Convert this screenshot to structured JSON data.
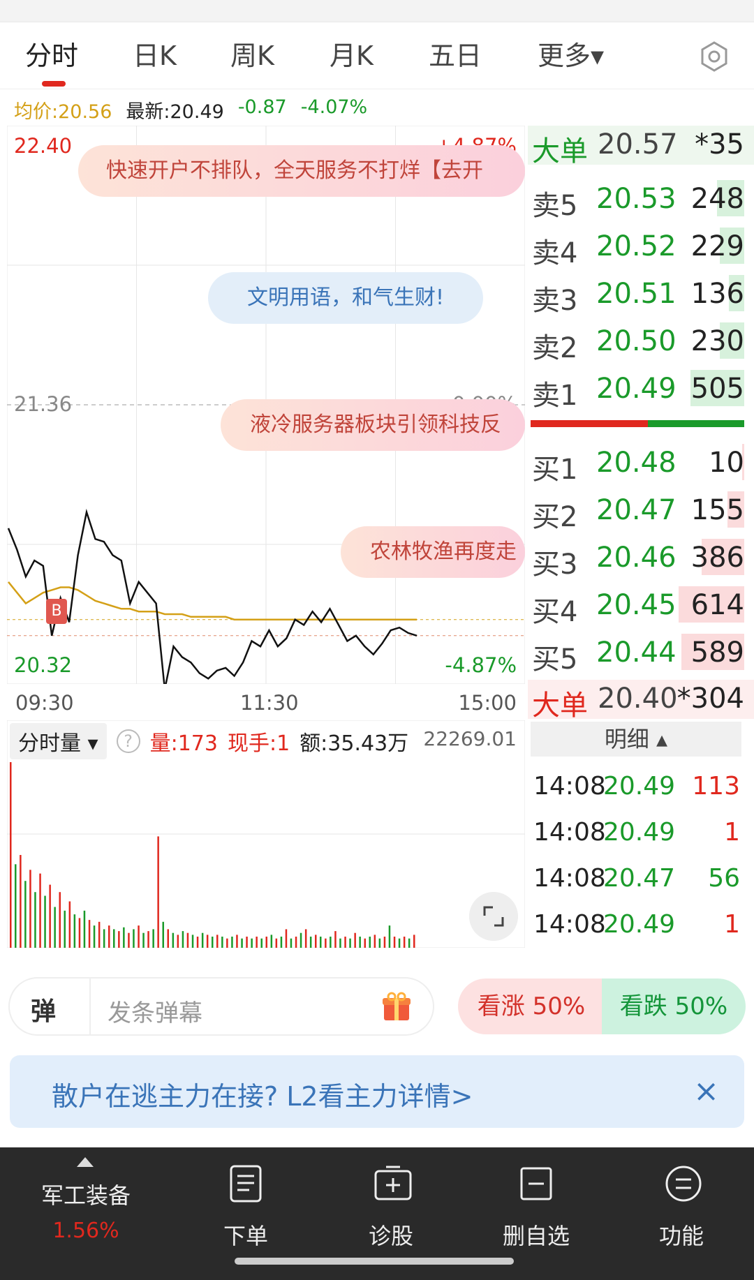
{
  "tabs": [
    {
      "label": "分时",
      "active": true
    },
    {
      "label": "日K"
    },
    {
      "label": "周K"
    },
    {
      "label": "月K"
    },
    {
      "label": "五日"
    },
    {
      "label": "更多▾"
    }
  ],
  "info": {
    "avg": "均价:20.56",
    "latest": "最新:20.49",
    "change": "-0.87",
    "pct": "-4.07%"
  },
  "chart": {
    "y_top": "22.40",
    "y_mid": "21.36",
    "y_bottom": "20.32",
    "pct_top": "+4.87%",
    "pct_mid": "0.00%",
    "pct_bottom": "-4.87%",
    "x_labels": [
      "09:30",
      "11:30",
      "15:00"
    ],
    "marker": "B"
  },
  "chart_data": {
    "type": "line",
    "ylim": [
      20.32,
      22.4
    ],
    "reference": 21.36,
    "series": [
      {
        "values": [
          20.9,
          20.82,
          20.72,
          20.78,
          20.76,
          20.5,
          20.64,
          20.55,
          20.8,
          20.96,
          20.86,
          20.85,
          20.8,
          20.78,
          20.62,
          20.7,
          20.66,
          20.62,
          20.3,
          20.46,
          20.42,
          20.4,
          20.36,
          20.34,
          20.37,
          20.38,
          20.35,
          20.4,
          20.48,
          20.46,
          20.52,
          20.46,
          20.49,
          20.56,
          20.54,
          20.59,
          20.55,
          20.6,
          20.54,
          20.48,
          20.5,
          20.46,
          20.43,
          20.47,
          20.52,
          20.53,
          20.51,
          20.5
        ]
      },
      {
        "values": [
          20.7,
          20.66,
          20.62,
          20.64,
          20.66,
          20.67,
          20.68,
          20.68,
          20.67,
          20.65,
          20.63,
          20.62,
          20.61,
          20.6,
          20.6,
          20.59,
          20.59,
          20.59,
          20.58,
          20.58,
          20.58,
          20.57,
          20.57,
          20.57,
          20.57,
          20.57,
          20.56,
          20.56,
          20.56,
          20.56,
          20.56,
          20.56,
          20.56,
          20.56,
          20.56,
          20.56,
          20.56,
          20.56,
          20.56,
          20.56,
          20.56,
          20.56,
          20.56,
          20.56,
          20.56,
          20.56,
          20.56,
          20.56
        ]
      }
    ]
  },
  "banners": {
    "b1": "快速开户不排队，全天服务不打烊【去开",
    "b2": "文明用语，和气生财!",
    "b3": "液冷服务器板块引领科技反",
    "b4": "农林牧渔再度走"
  },
  "volume": {
    "selector": "分时量",
    "selector_arrow": "▾",
    "help": "?",
    "vol": "量:173",
    "hand": "现手:1",
    "amount": "额:35.43万",
    "max": "22269.01"
  },
  "volume_data": {
    "values": [
      1.0,
      0.45,
      0.5,
      0.36,
      0.42,
      0.3,
      0.4,
      0.28,
      0.34,
      0.22,
      0.3,
      0.2,
      0.25,
      0.18,
      0.16,
      0.2,
      0.15,
      0.12,
      0.14,
      0.1,
      0.12,
      0.1,
      0.09,
      0.11,
      0.08,
      0.1,
      0.12,
      0.08,
      0.09,
      0.1,
      0.6,
      0.14,
      0.1,
      0.08,
      0.07,
      0.09,
      0.08,
      0.07,
      0.06,
      0.08,
      0.07,
      0.06,
      0.07,
      0.06,
      0.05,
      0.06,
      0.07,
      0.05,
      0.06,
      0.05,
      0.06,
      0.05,
      0.06,
      0.07,
      0.05,
      0.06,
      0.1,
      0.05,
      0.06,
      0.08,
      0.1,
      0.06,
      0.07,
      0.06,
      0.05,
      0.06,
      0.09,
      0.05,
      0.06,
      0.05,
      0.08,
      0.06,
      0.05,
      0.06,
      0.07,
      0.05,
      0.06,
      0.12,
      0.06,
      0.05,
      0.06,
      0.05,
      0.07
    ]
  },
  "orderbook": {
    "big_top": {
      "label": "大单",
      "price": "20.57",
      "qty": "*35"
    },
    "asks": [
      {
        "label": "卖5",
        "price": "20.53",
        "qty": "248",
        "level": 0.35
      },
      {
        "label": "卖4",
        "price": "20.52",
        "qty": "229",
        "level": 0.32
      },
      {
        "label": "卖3",
        "price": "20.51",
        "qty": "136",
        "level": 0.2
      },
      {
        "label": "卖2",
        "price": "20.50",
        "qty": "230",
        "level": 0.32
      },
      {
        "label": "卖1",
        "price": "20.49",
        "qty": "505",
        "level": 0.7
      }
    ],
    "bids": [
      {
        "label": "买1",
        "price": "20.48",
        "qty": "10",
        "level": 0.03
      },
      {
        "label": "买2",
        "price": "20.47",
        "qty": "155",
        "level": 0.22
      },
      {
        "label": "买3",
        "price": "20.46",
        "qty": "386",
        "level": 0.55
      },
      {
        "label": "买4",
        "price": "20.45",
        "qty": "614",
        "level": 0.85
      },
      {
        "label": "买5",
        "price": "20.44",
        "qty": "589",
        "level": 0.82
      }
    ],
    "big_bottom": {
      "label": "大单",
      "price": "20.40",
      "qty": "*304"
    }
  },
  "detail": {
    "header": "明细 ▴",
    "rows": [
      {
        "time": "14:08",
        "price": "20.49",
        "vol": "113",
        "dir": "red"
      },
      {
        "time": "14:08",
        "price": "20.49",
        "vol": "1",
        "dir": "red"
      },
      {
        "time": "14:08",
        "price": "20.47",
        "vol": "56",
        "dir": "green"
      },
      {
        "time": "14:08",
        "price": "20.49",
        "vol": "1",
        "dir": "red"
      }
    ]
  },
  "barrage": {
    "tag": "弹",
    "placeholder": "发条弹幕"
  },
  "vote": {
    "up": "看涨 50%",
    "down": "看跌 50%"
  },
  "promo": {
    "text": "散户在逃主力在接? L2看主力详情>",
    "close": "×"
  },
  "nav": {
    "sector_name": "军工装备",
    "sector_pct": "1.56%",
    "items": [
      "下单",
      "诊股",
      "删自选",
      "功能"
    ]
  },
  "colors": {
    "up": "#e0281e",
    "down": "#1a9a2a",
    "avg": "#d4a017"
  }
}
